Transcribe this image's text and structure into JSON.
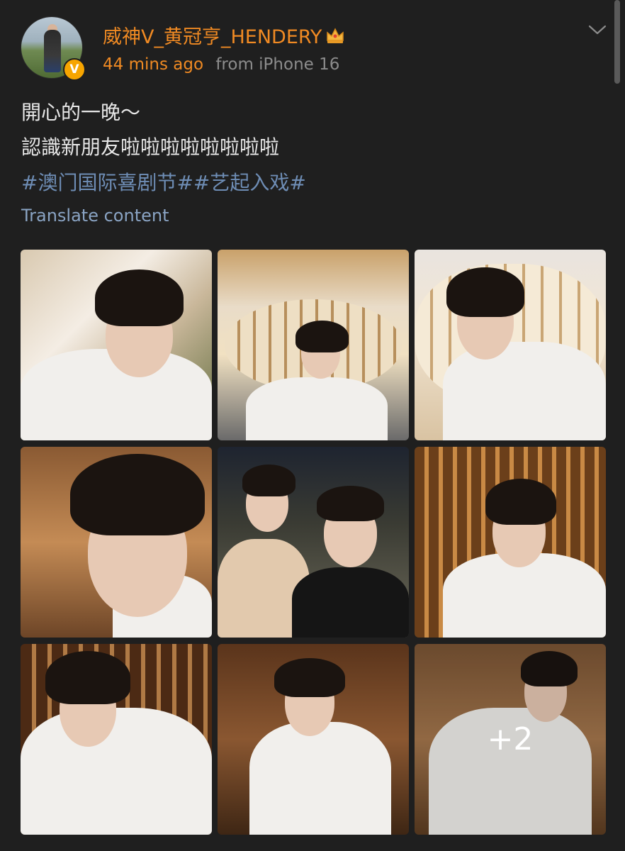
{
  "post": {
    "username": "威神V_黄冠亨_HENDERY",
    "time_ago": "44 mins ago",
    "source": "from iPhone 16",
    "text_lines": [
      "開心的一晚～",
      "認識新朋友啦啦啦啦啦啦啦啦"
    ],
    "hashtags": "#澳门国际喜剧节##艺起入戏#",
    "translate_label": "Translate content",
    "extra_photos_label": "+2"
  },
  "icons": {
    "verified": "verified-v-icon",
    "crown": "crown-icon",
    "chevron": "chevron-down-icon"
  },
  "colors": {
    "background": "#1f1f1f",
    "username": "#f08a23",
    "hashtag": "#6e8db5",
    "translate": "#8aa4c4",
    "meta_gray": "#8c8c8c"
  },
  "photos": [
    {
      "id": "photo-1"
    },
    {
      "id": "photo-2"
    },
    {
      "id": "photo-3"
    },
    {
      "id": "photo-4"
    },
    {
      "id": "photo-5"
    },
    {
      "id": "photo-6"
    },
    {
      "id": "photo-7"
    },
    {
      "id": "photo-8"
    },
    {
      "id": "photo-9"
    }
  ]
}
